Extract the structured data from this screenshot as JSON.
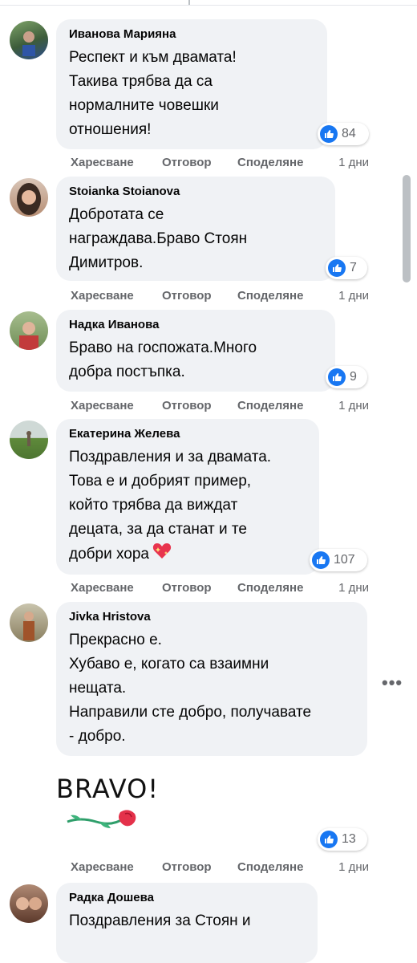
{
  "colors": {
    "like_blue": "#1877f2",
    "bubble_bg": "#f0f2f5",
    "meta_grey": "#65676b"
  },
  "actions": {
    "like": "Харесване",
    "reply": "Отговор",
    "share": "Споделяне"
  },
  "comments": [
    {
      "author": "Иванова Марияна",
      "text": "Респект и към двамата!\nТакива трябва да са\nнормалните човешки\nотношения!",
      "reactions": "84",
      "time": "1 дни"
    },
    {
      "author": "Stoianka Stoianova",
      "text": "Добротата се\nнаграждава.Браво Стоян\nДимитров.",
      "reactions": "7",
      "time": "1 дни"
    },
    {
      "author": "Надка Иванова",
      "text": "Браво на госпожата.Много\nдобра постъпка.",
      "reactions": "9",
      "time": "1 дни"
    },
    {
      "author": "Екатерина Желева",
      "text": "Поздравления и за двамата.\nТова е и добрият пример,\nкойто трябва да виждат\nдецата, за да станат и те\nдобри хора",
      "emoji": "sparkling-heart",
      "reactions": "107",
      "time": "1 дни"
    },
    {
      "author": "Jivka Hristova",
      "text": "Прекрасно е.\nХубаво е, когато са взаимни\nнещата.\nНаправили сте добро, получавате\n- добро.",
      "sticker": "BRAVO!",
      "reactions": "13",
      "time": "1 дни"
    },
    {
      "author": "Радка Дошева",
      "text": "Поздравления за Стоян и"
    }
  ],
  "more_options_icon": "more-options-icon",
  "like_icon": "thumbs-up-icon"
}
